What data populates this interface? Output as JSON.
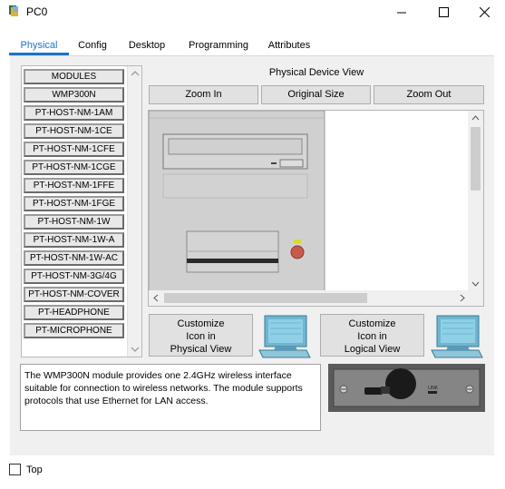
{
  "window": {
    "title": "PC0",
    "minimize_glyph": "—",
    "maximize_glyph": "☐",
    "close_glyph": "✕"
  },
  "tabs": [
    {
      "label": "Physical",
      "active": true
    },
    {
      "label": "Config",
      "active": false
    },
    {
      "label": "Desktop",
      "active": false
    },
    {
      "label": "Programming",
      "active": false
    },
    {
      "label": "Attributes",
      "active": false
    }
  ],
  "modules": {
    "items": [
      "MODULES",
      "WMP300N",
      "PT-HOST-NM-1AM",
      "PT-HOST-NM-1CE",
      "PT-HOST-NM-1CFE",
      "PT-HOST-NM-1CGE",
      "PT-HOST-NM-1FFE",
      "PT-HOST-NM-1FGE",
      "PT-HOST-NM-1W",
      "PT-HOST-NM-1W-A",
      "PT-HOST-NM-1W-AC",
      "PT-HOST-NM-3G/4G",
      "PT-HOST-NM-COVER",
      "PT-HEADPHONE",
      "PT-MICROPHONE"
    ]
  },
  "physical_view": {
    "title": "Physical Device View",
    "zoom_in": "Zoom In",
    "original_size": "Original Size",
    "zoom_out": "Zoom Out"
  },
  "customize": {
    "physical": [
      "Customize",
      "Icon in",
      "Physical View"
    ],
    "logical": [
      "Customize",
      "Icon in",
      "Logical View"
    ]
  },
  "description": "The WMP300N module provides one 2.4GHz wireless interface suitable for connection to wireless networks. The module supports protocols that use Ethernet for LAN access.",
  "module_image": {
    "link_label": "LINK"
  },
  "footer": {
    "top_label": "Top"
  },
  "colors": {
    "accent": "#1a73c8",
    "link_led": "#d8d830",
    "power_button": "#c85a4a"
  }
}
